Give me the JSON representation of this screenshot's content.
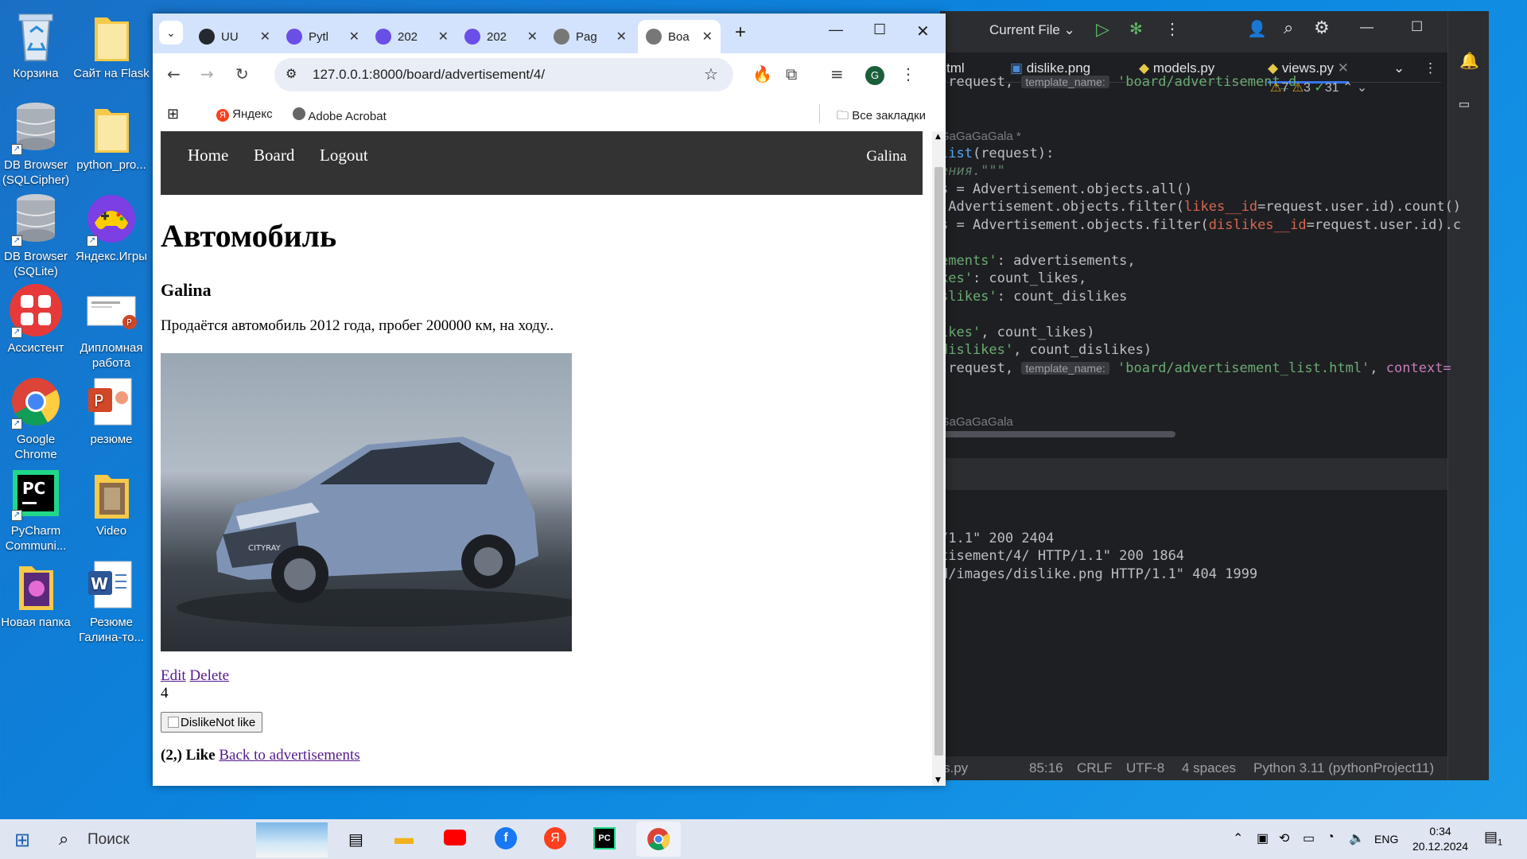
{
  "desktop": {
    "icons": [
      {
        "label": "Корзина"
      },
      {
        "label": "Сайт на Flask"
      },
      {
        "label": "DB Browser (SQLCipher)"
      },
      {
        "label": "python_pro..."
      },
      {
        "label": "DB Browser (SQLite)"
      },
      {
        "label": "Яндекс.Игры"
      },
      {
        "label": "Ассистент"
      },
      {
        "label": "Дипломная работа"
      },
      {
        "label": "Google Chrome"
      },
      {
        "label": "резюме"
      },
      {
        "label": "PyCharm Communi..."
      },
      {
        "label": "Video"
      },
      {
        "label": "Новая папка"
      },
      {
        "label": "Резюме Галина-то..."
      }
    ]
  },
  "pycharm": {
    "run_config": "Current File",
    "tabs": [
      "tml",
      "dislike.png",
      "models.py",
      "views.py"
    ],
    "inspections": {
      "warnings": "7",
      "weak": "3",
      "ok": "31"
    },
    "author1": "GaGaGaGala *",
    "author2": "GaGaGaGala",
    "hint_template_name": "template_name:",
    "code": {
      "l1_pre": "(request, ",
      "l1_str": "'board/advertisement_d",
      "l3_fn": "list",
      "l3_rest": "(request):",
      "l4": "ения.\"\"\"",
      "l5": "s = Advertisement.objects.all()",
      "l6a": " Advertisement.objects.filter(",
      "l6b": "likes__id",
      "l6c": "=request.user.id).count()",
      "l7a": "s = Advertisement.objects.filter(",
      "l7b": "dislikes__id",
      "l7c": "=request.user.id).c",
      "l9a": "ements'",
      "l9b": ": advertisements,",
      "l10a": "kes'",
      "l10b": ": count_likes,",
      "l11a": "slikes'",
      "l11b": ": count_dislikes",
      "l13a": "ikes'",
      "l13b": ", count_likes)",
      "l14a": "dislikes'",
      "l14b": ", count_dislikes)",
      "l15_pre": "(request, ",
      "l15_str": "'board/advertisement_list.html'",
      "l15_post": ", ",
      "l15_ctx": "context="
    },
    "console": [
      "/1.1\" 200 2404",
      "tisement/4/ HTTP/1.1\" 200 1864",
      "d/images/dislike.png HTTP/1.1\" 404 1999"
    ],
    "status": {
      "file": "s.py",
      "position": "85:16",
      "line_sep": "CRLF",
      "encoding": "UTF-8",
      "indent": "4 spaces",
      "interpreter": "Python 3.11 (pythonProject11)"
    }
  },
  "chrome": {
    "tabs": [
      {
        "title": "UU",
        "icon": "github-icon"
      },
      {
        "title": "Pytl",
        "icon": "course-icon"
      },
      {
        "title": "202",
        "icon": "course-icon"
      },
      {
        "title": "202",
        "icon": "course-icon"
      },
      {
        "title": "Pag",
        "icon": "globe-icon"
      },
      {
        "title": "Boa",
        "icon": "globe-icon"
      }
    ],
    "url": "127.0.0.1:8000/board/advertisement/4/",
    "profile_initial": "G",
    "bookmarks": [
      "Яндекс",
      "Adobe Acrobat"
    ],
    "all_bookmarks": "Все закладки"
  },
  "page": {
    "nav": {
      "home": "Home",
      "board": "Board",
      "logout": "Logout",
      "user": "Galina"
    },
    "title": "Автомобиль",
    "author": "Galina",
    "description": "Продаётся автомобиль 2012 года, пробег 200000 км, на ходу..",
    "car_badge": "CITYRAY",
    "edit": "Edit",
    "delete": "Delete",
    "count": "4",
    "dislike_btn": "DislikeNot like",
    "likes_text": "(2,) Like",
    "back_link": "Back to advertisements"
  },
  "taskbar": {
    "search": "Поиск",
    "lang": "ENG",
    "time": "0:34",
    "date": "20.12.2024",
    "notifications": "1"
  }
}
